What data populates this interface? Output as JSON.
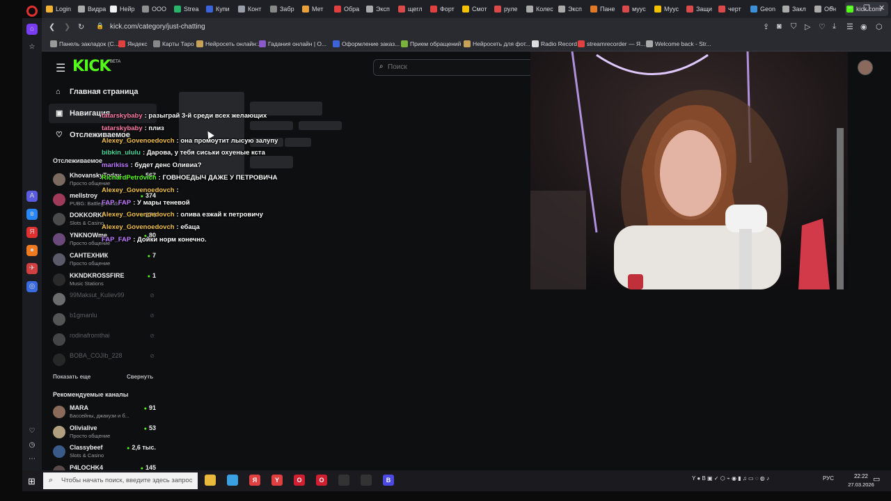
{
  "browser": {
    "tabs": [
      {
        "label": "Login",
        "color": "#f2b233"
      },
      {
        "label": "Видра",
        "color": "#aaaaaa"
      },
      {
        "label": "Нейр",
        "color": "#f3f3f3"
      },
      {
        "label": "ООО",
        "color": "#8f8f8f"
      },
      {
        "label": "Strea",
        "color": "#29b36b"
      },
      {
        "label": "Купи",
        "color": "#3d63d8"
      },
      {
        "label": "Конт",
        "color": "#9aa0aa"
      },
      {
        "label": "Забр",
        "color": "#888888"
      },
      {
        "label": "Мет",
        "color": "#e9a23b"
      },
      {
        "label": "Обра",
        "color": "#e04040"
      },
      {
        "label": "Эксп",
        "color": "#aaaaaa"
      },
      {
        "label": "щегл",
        "color": "#d94a4a"
      },
      {
        "label": "Форт",
        "color": "#e04040"
      },
      {
        "label": "Смот",
        "color": "#f2c200"
      },
      {
        "label": "руле",
        "color": "#d94a4a"
      },
      {
        "label": "Колес",
        "color": "#aaaaaa"
      },
      {
        "label": "Эксп",
        "color": "#aaaaaa"
      },
      {
        "label": "Пане",
        "color": "#e07a2a"
      },
      {
        "label": "муус",
        "color": "#d94a4a"
      },
      {
        "label": "Муус",
        "color": "#f2c200"
      },
      {
        "label": "Защи",
        "color": "#d94a4a"
      },
      {
        "label": "черт",
        "color": "#d94a4a"
      },
      {
        "label": "Geon",
        "color": "#3d8fd8"
      },
      {
        "label": "Закл",
        "color": "#aaaaaa"
      },
      {
        "label": "Обн",
        "color": "#aaaaaa"
      },
      {
        "label": "kick.com/",
        "color": "#53fc18"
      }
    ],
    "new_tab": "+",
    "url": "kick.com/category/just-chatting",
    "bookmarks": [
      {
        "label": "Панель закладок (С...",
        "color": "#999999"
      },
      {
        "label": "Яндекс",
        "color": "#e04040"
      },
      {
        "label": "Карты Таро",
        "color": "#888888"
      },
      {
        "label": "Нейросеть онлайн:...",
        "color": "#c9a25a"
      },
      {
        "label": "Гадания онлайн | О...",
        "color": "#8a5ac9"
      },
      {
        "label": "Оформление заказ...",
        "color": "#3d63d8"
      },
      {
        "label": "Прием обращений",
        "color": "#7ab33d"
      },
      {
        "label": "Нейросеть для фот...",
        "color": "#c9a25a"
      },
      {
        "label": "Radio Record",
        "color": "#dddddd"
      },
      {
        "label": "streamrecorder — Я...",
        "color": "#e04040"
      },
      {
        "label": "Welcome back - Str...",
        "color": "#aaaaaa"
      }
    ]
  },
  "kick": {
    "logo": "KICK",
    "beta": "BETA",
    "search_placeholder": "Поиск",
    "nav": {
      "home": "Главная страница",
      "browse": "Навигация",
      "following": "Отслеживаемое"
    },
    "following_title": "Отслеживаемое",
    "following": [
      {
        "name": "KhovanskyToday",
        "category": "Просто общение",
        "viewers": "567",
        "color": "#7a6a60"
      },
      {
        "name": "mellstroy",
        "category": "PUBG: Battlegrounds",
        "viewers": "374",
        "color": "#a03a5a"
      },
      {
        "name": "DOKKORKI",
        "category": "Slots & Casino",
        "viewers": "274",
        "color": "#4a4a4a"
      },
      {
        "name": "YNKNOWme",
        "category": "Просто общение",
        "viewers": "80",
        "color": "#6a4a7a"
      },
      {
        "name": "САНТЕХНИК",
        "category": "Просто общение",
        "viewers": "7",
        "color": "#5a5a6a"
      },
      {
        "name": "KKNDKROSSFIRE",
        "category": "Music Stations",
        "viewers": "1",
        "color": "#2a2a2a"
      }
    ],
    "offline": [
      {
        "name": "99Maksut_Kuliev99",
        "color": "#dddddd"
      },
      {
        "name": "b1gmanlu",
        "color": "#aaaaaa"
      },
      {
        "name": "rodinafromthai",
        "color": "#888888"
      },
      {
        "name": "BOBA_COJIb_228",
        "color": "#444444"
      }
    ],
    "show_more": "Показать еще",
    "collapse": "Свернуть",
    "recommended_title": "Рекомендуемые каналы",
    "recommended": [
      {
        "name": "MARA",
        "category": "Бассейны, джакузи и б...",
        "viewers": "91",
        "color": "#8a6a5a"
      },
      {
        "name": "Olivialive",
        "category": "Просто общение",
        "viewers": "53",
        "color": "#b0a080"
      },
      {
        "name": "Classybeef",
        "category": "Slots & Casino",
        "viewers": "2,6 тыс.",
        "color": "#3a5a8a"
      },
      {
        "name": "P4LOCHK4",
        "category": "",
        "viewers": "145",
        "color": "#5a4a4a"
      }
    ]
  },
  "chat": [
    {
      "user": "tatarskybaby",
      "color": "#ff7aa8",
      "text": ": разыграй 3-й среди всех желающих"
    },
    {
      "user": "tatarskybaby",
      "color": "#ff7aa8",
      "text": ": плиз"
    },
    {
      "user": "Alexey_Govenoedovch",
      "color": "#f5c34a",
      "text": ": она промоутит лысую залупу"
    },
    {
      "user": "bibkin_ululu",
      "color": "#4ad9a0",
      "text": ": Дарова, у тебя сиськи охуеные кста"
    },
    {
      "user": "marikiss",
      "color": "#c07aff",
      "text": ": будет денс Оливиа?"
    },
    {
      "user": "RichardPetrovich",
      "color": "#53fc18",
      "text": ": ГОВНОЕДЫЧ ДАЖЕ У ПЕТРОВИЧА"
    },
    {
      "user": "Alexey_Govenoedovch",
      "color": "#f5c34a",
      "text": ":"
    },
    {
      "user": "FAP_FAP",
      "color": "#c07aff",
      "text": ": У мары теневой"
    },
    {
      "user": "Alexey_Govenoedovch",
      "color": "#f5c34a",
      "text": ": олива езжай к петровичу"
    },
    {
      "user": "Alexey_Govenoedovch",
      "color": "#f5c34a",
      "text": ": ебаца"
    },
    {
      "user": "FAP_FAP",
      "color": "#c07aff",
      "text": ": Дойки норм конечно."
    }
  ],
  "taskbar": {
    "search_placeholder": "Чтобы начать поиск, введите здесь запрос",
    "apps": [
      {
        "label": "",
        "color": "#e9b93b"
      },
      {
        "label": "",
        "color": "#3aa0e0"
      },
      {
        "label": "Я",
        "color": "#e04040"
      },
      {
        "label": "Y",
        "color": "#e04040"
      },
      {
        "label": "O",
        "color": "#d02030"
      },
      {
        "label": "O",
        "color": "#d02030"
      },
      {
        "label": "",
        "color": "#333333"
      },
      {
        "label": "",
        "color": "#333333"
      },
      {
        "label": "B",
        "color": "#4a4ae0"
      }
    ],
    "lang": "РУС",
    "time": "22:22",
    "date": "27.03.2026"
  }
}
